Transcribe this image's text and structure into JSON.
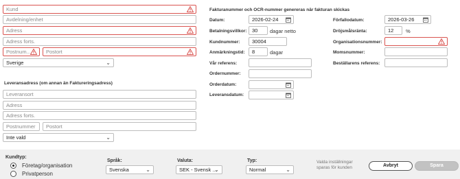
{
  "left": {
    "name_ph": "Kund",
    "dept_ph": "Avdelning/enhet",
    "addr_ph": "Adress",
    "addr2_ph": "Adress forts.",
    "zip_ph": "Postnum...",
    "city_ph": "Postort",
    "country": "Sverige",
    "delivery_title": "Leveransadress (om annan än Faktureringsadress)",
    "del_name_ph": "Leveransort",
    "del_addr_ph": "Adress",
    "del_addr2_ph": "Adress forts.",
    "del_zip_ph": "Postnummer",
    "del_city_ph": "Postort",
    "del_country": "Inte vald"
  },
  "right": {
    "notice": "Fakturanummer och OCR-nummer genereras när fakturan skickas",
    "date_label": "Datum:",
    "date_value": "2026-02-24",
    "terms_label": "Betalningsvillkor:",
    "terms_value": "30",
    "terms_unit": "dagar netto",
    "custno_label": "Kundnummer:",
    "custno_value": "30004",
    "remark_label": "Anmärkningstid:",
    "remark_value": "8",
    "remark_unit": "dagar",
    "yourref_label": "Vår referens:",
    "ordno_label": "Ordernummer:",
    "orddate_label": "Orderdatum:",
    "deldate_label": "Leveransdatum:",
    "due_label": "Förfallodatum:",
    "due_value": "2026-03-26",
    "late_label": "Dröjsmålsränta:",
    "late_value": "12",
    "late_unit": "%",
    "orgno_label": "Organisationsnummer:",
    "vat_label": "Momsnummer:",
    "buyerref_label": "Beställarens referens:"
  },
  "footer": {
    "custtype_label": "Kundtyp:",
    "opt_company": "Företag/organisation",
    "opt_private": "Privatperson",
    "lang_label": "Språk:",
    "lang_value": "Svenska",
    "currency_label": "Valuta:",
    "currency_value": "SEK - Svensk ...",
    "type_label": "Typ:",
    "type_value": "Normal",
    "save_note_1": "Valda inställningar",
    "save_note_2": "sparas för kunden",
    "cancel": "Avbryt",
    "save": "Spara"
  },
  "colors": {
    "error": "#d9534f",
    "footer_bg": "#f0f0f0"
  }
}
